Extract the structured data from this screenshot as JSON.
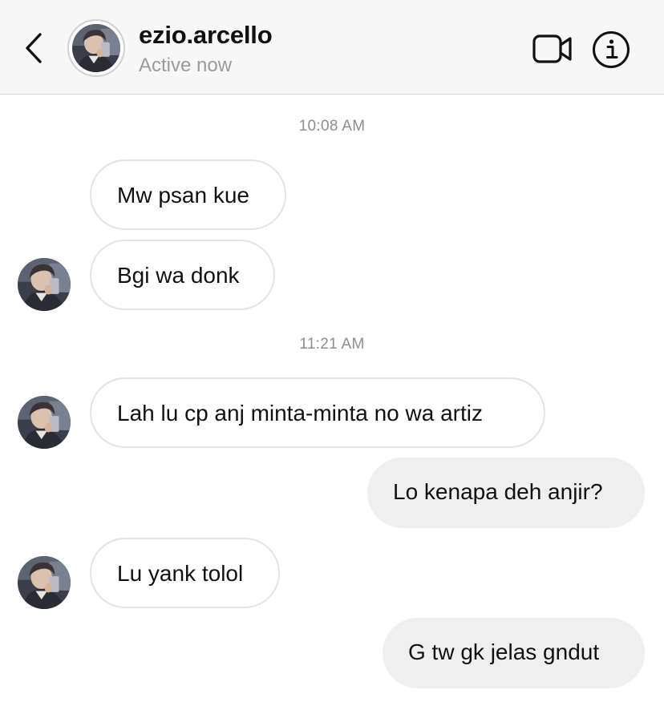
{
  "header": {
    "username": "ezio.arcello",
    "status": "Active now",
    "icons": {
      "back": "chevron-left-icon",
      "video": "video-camera-icon",
      "info": "info-icon"
    }
  },
  "thread": {
    "timestamps": [
      "10:08 AM",
      "11:21 AM"
    ],
    "messages": [
      {
        "from": "them",
        "text": "Mw psan kue"
      },
      {
        "from": "them",
        "text": "Bgi wa donk"
      },
      {
        "from": "them",
        "text": "Lah lu cp anj minta-minta no wa artiz"
      },
      {
        "from": "me",
        "text": "Lo kenapa deh anjir?"
      },
      {
        "from": "them",
        "text": "Lu yank tolol"
      },
      {
        "from": "me",
        "text": "G tw gk jelas gndut"
      }
    ]
  },
  "colors": {
    "header_bg": "#f7f7f7",
    "incoming_border": "#e3e3e3",
    "outgoing_bg": "#efefef",
    "muted_text": "#8e8e8e"
  }
}
